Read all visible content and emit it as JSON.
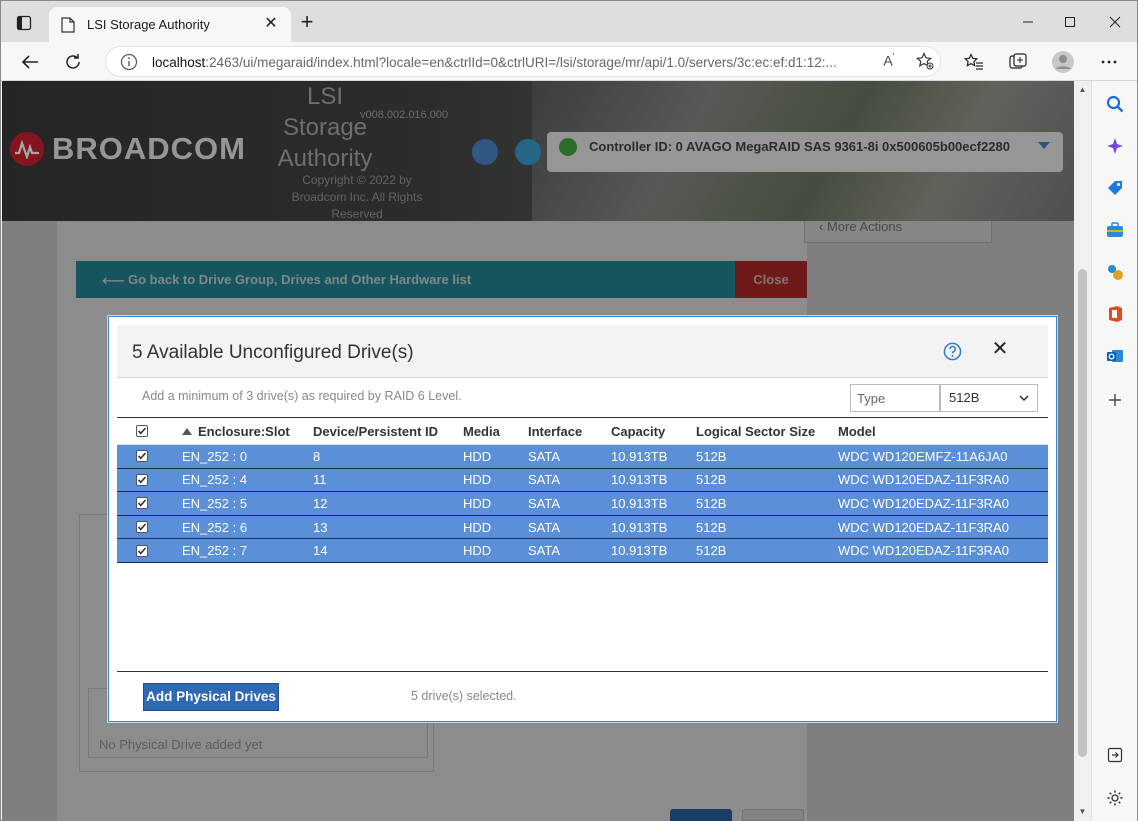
{
  "browser": {
    "tab_title": "LSI Storage Authority",
    "url_host": "localhost",
    "url_rest": ":2463/ui/megaraid/index.html?locale=en&ctrlId=0&ctrlURI=/lsi/storage/mr/api/1.0/servers/3c:ec:ef:d1:12:..."
  },
  "app": {
    "brand": "BROADCOM",
    "name_line1": "LSI",
    "name_line2": "Storage",
    "name_line3": "Authority",
    "version": "v008.002.016.000",
    "copyright_line1": "Copyright © 2022 by",
    "copyright_line2": "Broadcom Inc. All Rights",
    "copyright_line3": "Reserved",
    "controller": "Controller ID: 0 AVAGO MegaRAID SAS 9361-8i 0x500605b00ecf2280",
    "more_actions": "More Actions",
    "go_back": "Go back to Drive Group, Drives and Other Hardware list",
    "close": "Close",
    "no_drive": "No Physical Drive added yet"
  },
  "modal": {
    "title": "5 Available Unconfigured Drive(s)",
    "hint": "Add a minimum of 3 drive(s) as required by RAID 6 Level.",
    "type_placeholder": "Type",
    "sector_filter": "512B",
    "columns": [
      "Enclosure:Slot",
      "Device/Persistent ID",
      "Media",
      "Interface",
      "Capacity",
      "Logical Sector Size",
      "Model"
    ],
    "rows": [
      {
        "slot": "EN_252 : 0",
        "id": "8",
        "media": "HDD",
        "iface": "SATA",
        "cap": "10.913TB",
        "sector": "512B",
        "model": "WDC WD120EMFZ-11A6JA0"
      },
      {
        "slot": "EN_252 : 4",
        "id": "11",
        "media": "HDD",
        "iface": "SATA",
        "cap": "10.913TB",
        "sector": "512B",
        "model": "WDC WD120EDAZ-11F3RA0"
      },
      {
        "slot": "EN_252 : 5",
        "id": "12",
        "media": "HDD",
        "iface": "SATA",
        "cap": "10.913TB",
        "sector": "512B",
        "model": "WDC WD120EDAZ-11F3RA0"
      },
      {
        "slot": "EN_252 : 6",
        "id": "13",
        "media": "HDD",
        "iface": "SATA",
        "cap": "10.913TB",
        "sector": "512B",
        "model": "WDC WD120EDAZ-11F3RA0"
      },
      {
        "slot": "EN_252 : 7",
        "id": "14",
        "media": "HDD",
        "iface": "SATA",
        "cap": "10.913TB",
        "sector": "512B",
        "model": "WDC WD120EDAZ-11F3RA0"
      }
    ],
    "add_button": "Add Physical Drives",
    "selected": "5 drive(s) selected."
  },
  "colors": {
    "row_selected": "#5b8fd8",
    "teal_bar": "#2a9bab",
    "close_red": "#c9302c",
    "add_button": "#2f69b3",
    "modal_border": "#3d8bc7"
  }
}
